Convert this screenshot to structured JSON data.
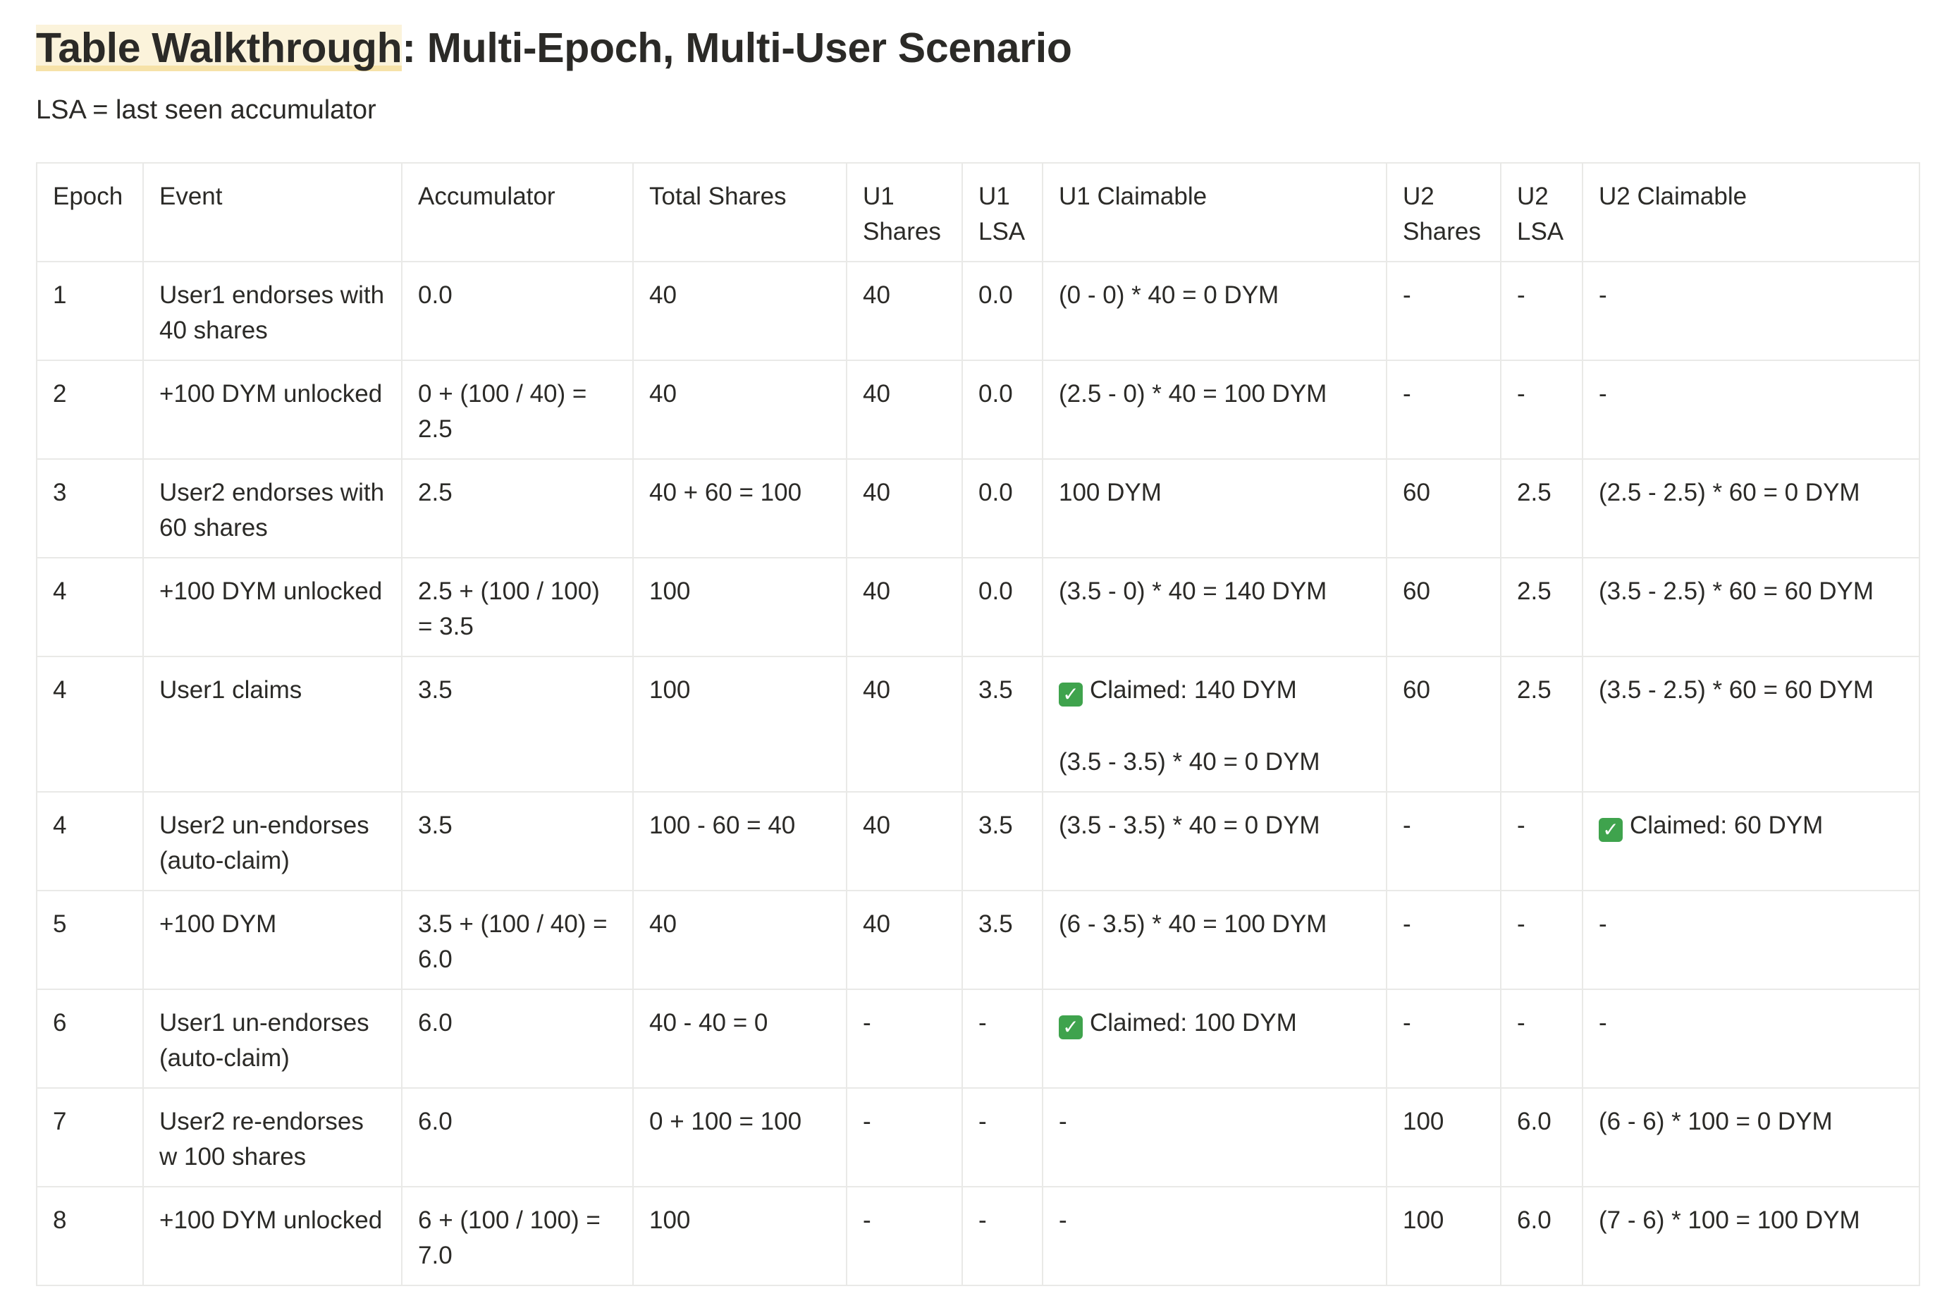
{
  "heading": {
    "highlight": "Table Walkthrough",
    "rest": ": Multi-Epoch, Multi-User Scenario"
  },
  "subtitle": "LSA = last seen accumulator",
  "table": {
    "headers": [
      "Epoch",
      "Event",
      "Accumulator",
      "Total Shares",
      "U1 Shares",
      "U1 LSA",
      "U1 Claimable",
      "U2 Shares",
      "U2 LSA",
      "U2 Claimable"
    ],
    "rows": [
      {
        "epoch": "1",
        "event": "User1 endorses with 40 shares",
        "accumulator": "0.0",
        "total_shares": "40",
        "u1_shares": "40",
        "u1_lsa": "0.0",
        "u1_claimable": "(0 - 0) * 40 = 0 DYM",
        "u2_shares": "-",
        "u2_lsa": "-",
        "u2_claimable": "-"
      },
      {
        "epoch": "2",
        "event": "+100 DYM unlocked",
        "accumulator": "0 + (100 / 40) = 2.5",
        "total_shares": "40",
        "u1_shares": "40",
        "u1_lsa": "0.0",
        "u1_claimable": "(2.5 - 0) * 40 = 100 DYM",
        "u2_shares": "-",
        "u2_lsa": "-",
        "u2_claimable": "-"
      },
      {
        "epoch": "3",
        "event": "User2 endorses with 60 shares",
        "accumulator": "2.5",
        "total_shares": "40 + 60 = 100",
        "u1_shares": "40",
        "u1_lsa": "0.0",
        "u1_claimable": "100 DYM",
        "u2_shares": "60",
        "u2_lsa": "2.5",
        "u2_claimable": "(2.5 - 2.5) * 60 = 0 DYM"
      },
      {
        "epoch": "4",
        "event": "+100 DYM unlocked",
        "accumulator": "2.5 + (100 / 100) = 3.5",
        "total_shares": "100",
        "u1_shares": "40",
        "u1_lsa": "0.0",
        "u1_claimable": "(3.5 - 0) * 40 = 140 DYM",
        "u2_shares": "60",
        "u2_lsa": "2.5",
        "u2_claimable": "(3.5 - 2.5) * 60 = 60 DYM"
      },
      {
        "epoch": "4",
        "event": "User1 claims",
        "accumulator": "3.5",
        "total_shares": "100",
        "u1_shares": "40",
        "u1_lsa": "3.5",
        "u1_claimable": "Claimed: 140 DYM",
        "u1_claimable_check": true,
        "u1_claimable_extra": "(3.5 - 3.5) * 40 = 0 DYM",
        "u2_shares": "60",
        "u2_lsa": "2.5",
        "u2_claimable": "(3.5 - 2.5) * 60 = 60 DYM"
      },
      {
        "epoch": "4",
        "event": "User2 un-endorses (auto-claim)",
        "accumulator": "3.5",
        "total_shares": "100 - 60 = 40",
        "u1_shares": "40",
        "u1_lsa": "3.5",
        "u1_claimable": "(3.5 - 3.5) * 40 = 0 DYM",
        "u2_shares": "-",
        "u2_lsa": "-",
        "u2_claimable": "Claimed: 60 DYM",
        "u2_claimable_check": true
      },
      {
        "epoch": "5",
        "event": "+100 DYM",
        "accumulator": "3.5 + (100 / 40) = 6.0",
        "total_shares": "40",
        "u1_shares": "40",
        "u1_lsa": "3.5",
        "u1_claimable": "(6 - 3.5) * 40 = 100 DYM",
        "u2_shares": "-",
        "u2_lsa": "-",
        "u2_claimable": "-"
      },
      {
        "epoch": "6",
        "event": "User1 un-endorses (auto-claim)",
        "accumulator": "6.0",
        "total_shares": "40 - 40 = 0",
        "u1_shares": "-",
        "u1_lsa": "-",
        "u1_claimable": "Claimed: 100 DYM",
        "u1_claimable_check": true,
        "u2_shares": "-",
        "u2_lsa": "-",
        "u2_claimable": "-"
      },
      {
        "epoch": "7",
        "event": "User2 re-endorses w 100 shares",
        "accumulator": "6.0",
        "total_shares": "0 + 100 = 100",
        "u1_shares": "-",
        "u1_lsa": "-",
        "u1_claimable": "-",
        "u2_shares": "100",
        "u2_lsa": "6.0",
        "u2_claimable": "(6 - 6) * 100 = 0 DYM"
      },
      {
        "epoch": "8",
        "event": "+100 DYM unlocked",
        "accumulator": "6 + (100 / 100) = 7.0",
        "total_shares": "100",
        "u1_shares": "-",
        "u1_lsa": "-",
        "u1_claimable": "-",
        "u2_shares": "100",
        "u2_lsa": "6.0",
        "u2_claimable": "(7 - 6) * 100 = 100 DYM"
      }
    ]
  }
}
